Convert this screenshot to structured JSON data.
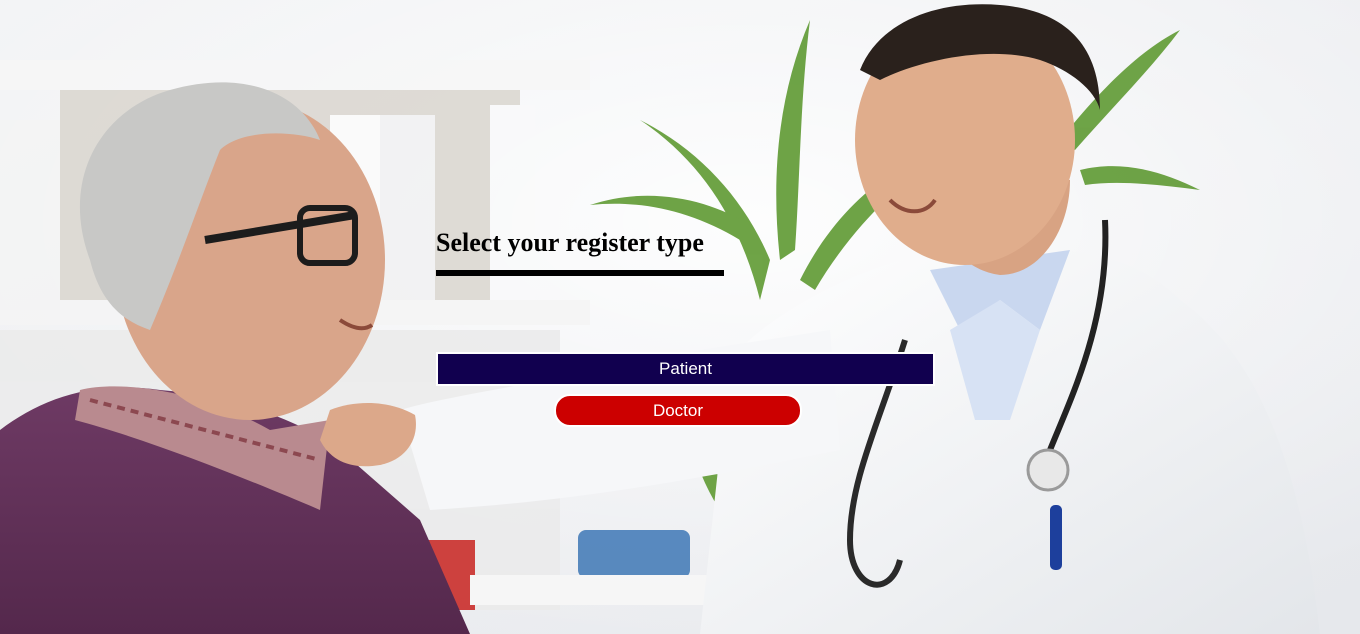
{
  "page": {
    "title": "Select your register type"
  },
  "register_options": {
    "patient_label": "Patient",
    "doctor_label": "Doctor"
  },
  "colors": {
    "patient_button": "#11004f",
    "doctor_button": "#cc0000",
    "title_text": "#000000"
  },
  "background": {
    "description_icon": "photo-background"
  }
}
